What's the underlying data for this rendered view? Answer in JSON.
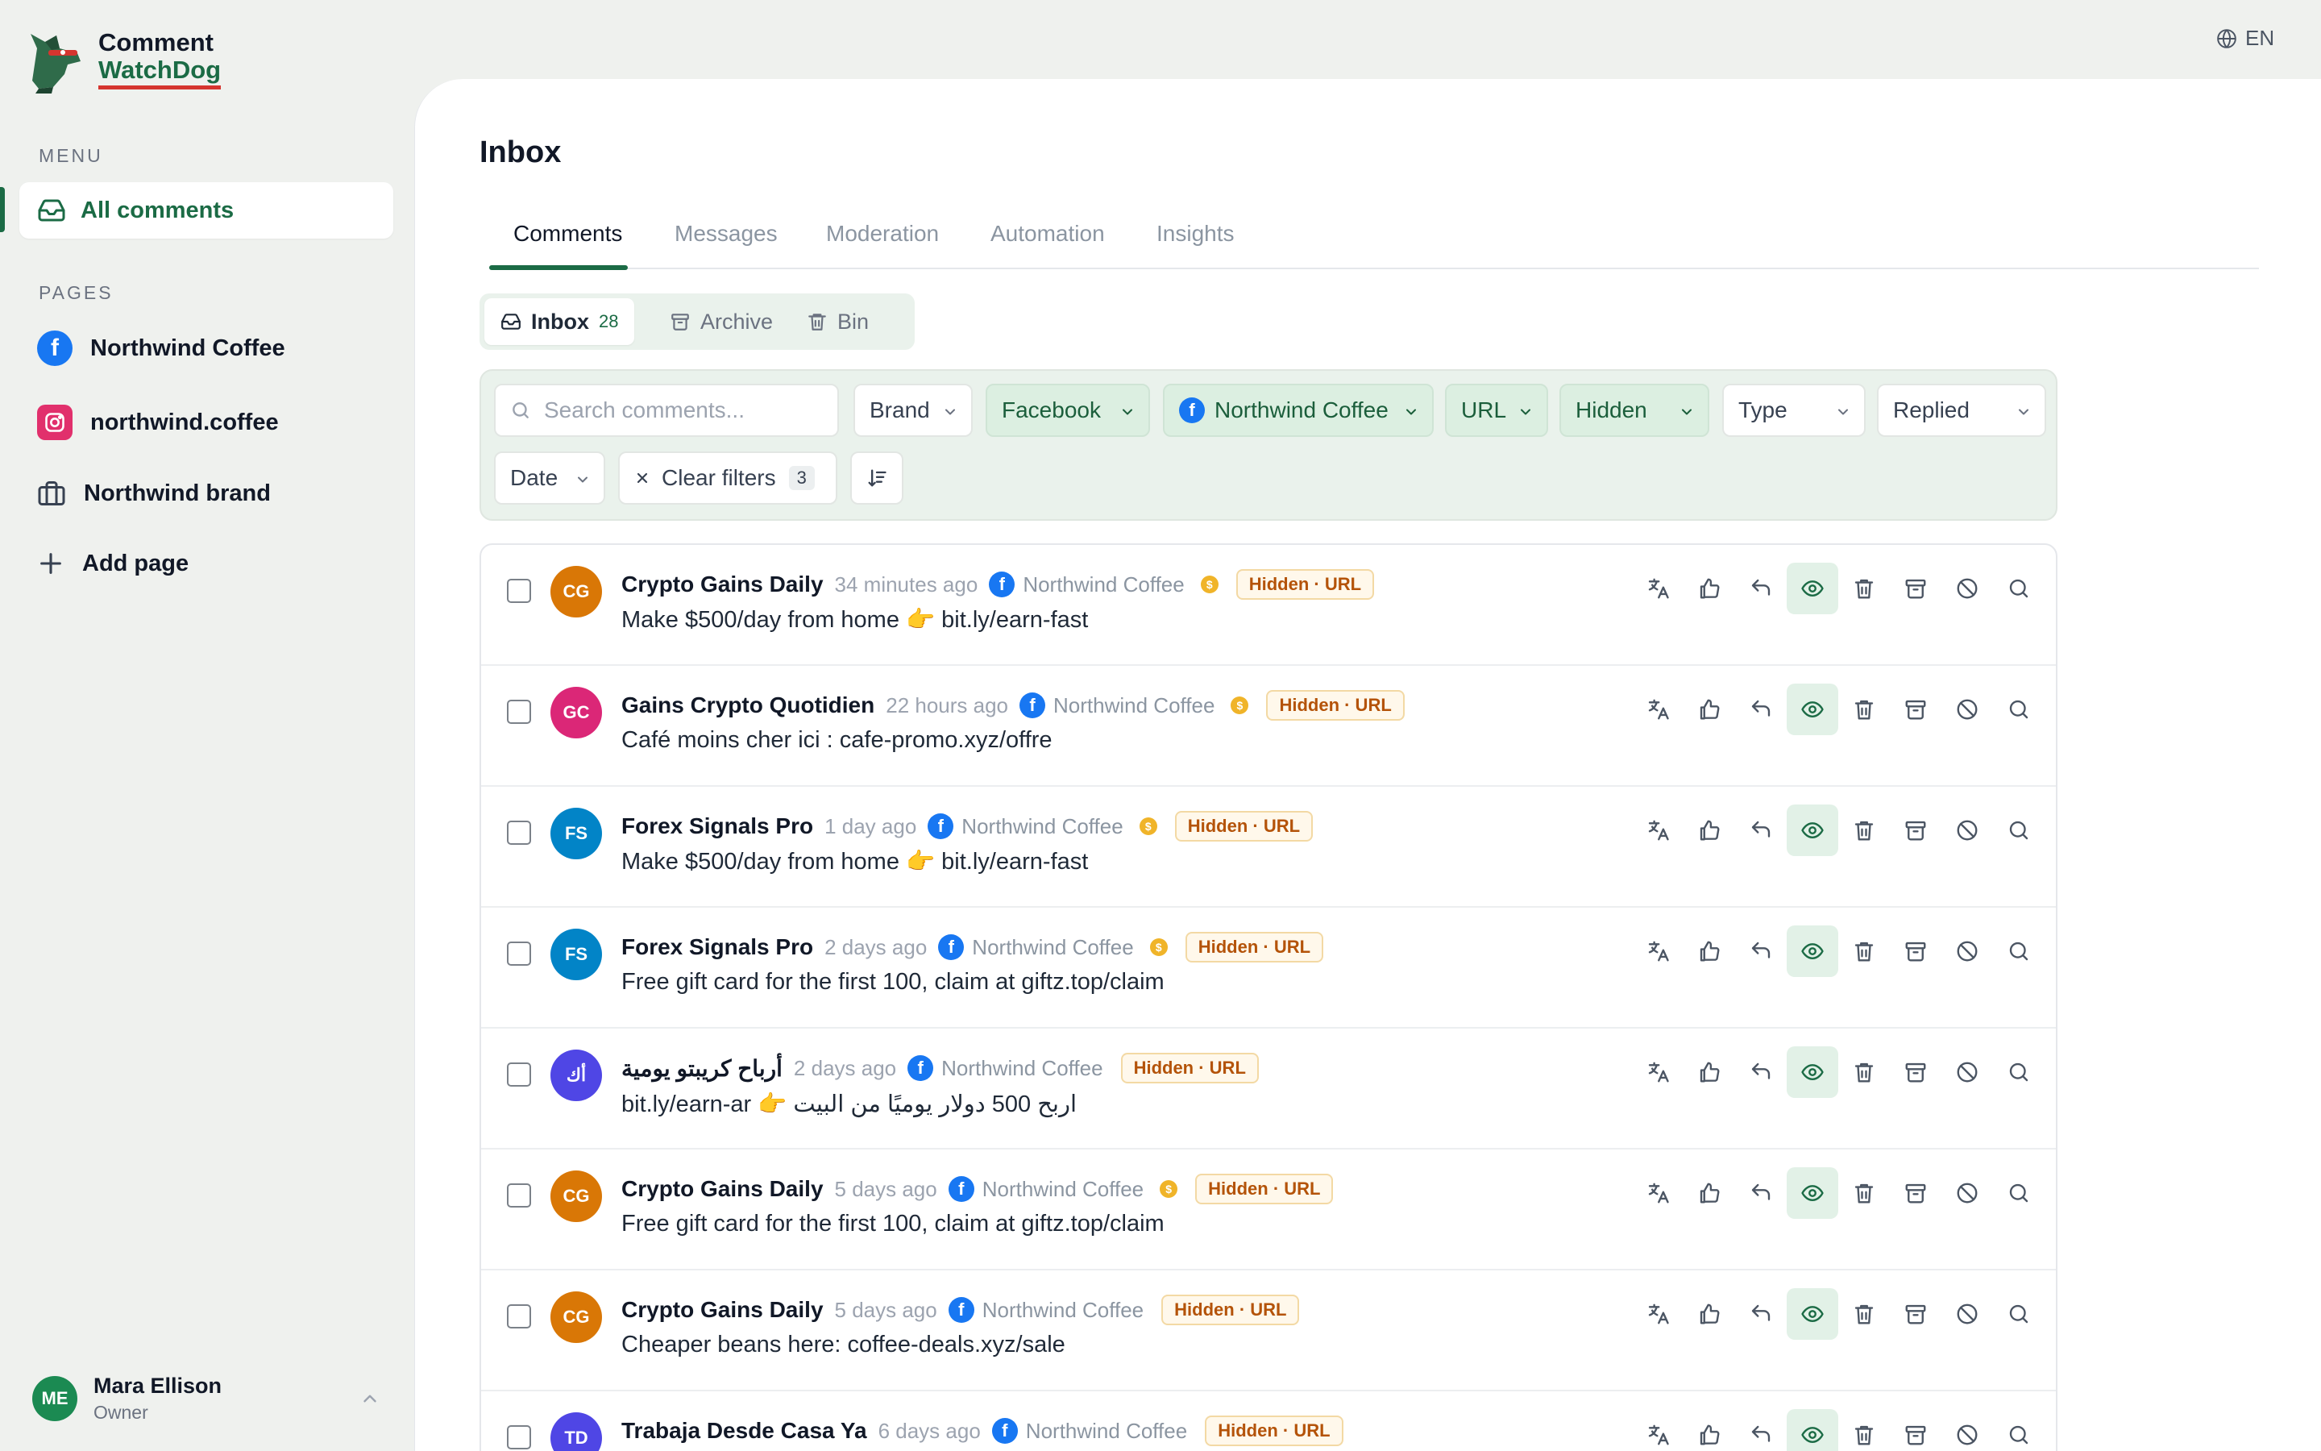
{
  "brand": {
    "line1": "Comment",
    "line2": "WatchDog"
  },
  "sidebar": {
    "menu_title": "MENU",
    "menu_items": [
      {
        "label": "All comments",
        "icon": "inbox-icon"
      }
    ],
    "pages_title": "PAGES",
    "pages": [
      {
        "label": "Northwind Coffee",
        "icon": "facebook-icon"
      },
      {
        "label": "northwind.coffee",
        "icon": "instagram-icon"
      },
      {
        "label": "Northwind brand",
        "icon": "briefcase-icon"
      }
    ],
    "add_page": "Add page",
    "user": {
      "initials": "ME",
      "name": "Mara Ellison",
      "role": "Owner"
    }
  },
  "lang": "EN",
  "main": {
    "title": "Inbox",
    "tabs": [
      "Comments",
      "Messages",
      "Moderation",
      "Automation",
      "Insights"
    ],
    "active_tab": "Comments",
    "segments": [
      {
        "label": "Inbox",
        "count": "28"
      },
      {
        "label": "Archive"
      },
      {
        "label": "Bin"
      }
    ],
    "filters": {
      "search_placeholder": "Search comments...",
      "brand": "Brand",
      "platform": "Facebook",
      "page": "Northwind Coffee",
      "url": "URL",
      "visibility": "Hidden",
      "type": "Type",
      "replied": "Replied",
      "date": "Date",
      "clear": "Clear filters",
      "clear_count": "3"
    }
  },
  "colors": {
    "accent": "#1b6b45",
    "facebook": "#1877f2",
    "tag": "#b45309"
  },
  "comments": [
    {
      "initials": "CG",
      "color": "#d97706",
      "author": "Crypto Gains Daily",
      "time": "34 minutes ago",
      "page": "Northwind Coffee",
      "coin": true,
      "tag": "Hidden · URL",
      "text": "Make $500/day from home 👉  bit.ly/earn-fast"
    },
    {
      "initials": "GC",
      "color": "#db2777",
      "author": "Gains Crypto Quotidien",
      "time": "22 hours ago",
      "page": "Northwind Coffee",
      "coin": true,
      "tag": "Hidden · URL",
      "text": "Café moins cher ici : cafe-promo.xyz/offre"
    },
    {
      "initials": "FS",
      "color": "#0284c7",
      "author": "Forex Signals Pro",
      "time": "1 day ago",
      "page": "Northwind Coffee",
      "coin": true,
      "tag": "Hidden · URL",
      "text": "Make $500/day from home 👉  bit.ly/earn-fast"
    },
    {
      "initials": "FS",
      "color": "#0284c7",
      "author": "Forex Signals Pro",
      "time": "2 days ago",
      "page": "Northwind Coffee",
      "coin": true,
      "tag": "Hidden · URL",
      "text": "Free gift card for the first 100, claim at giftz.top/claim"
    },
    {
      "initials": "أك",
      "color": "#4f46e5",
      "author": "أرباح كريبتو يومية",
      "time": "2 days ago",
      "page": "Northwind Coffee",
      "coin": false,
      "tag": "Hidden · URL",
      "text": "bit.ly/earn-ar 👉  اربح 500 دولار يوميًا من البيت"
    },
    {
      "initials": "CG",
      "color": "#d97706",
      "author": "Crypto Gains Daily",
      "time": "5 days ago",
      "page": "Northwind Coffee",
      "coin": true,
      "tag": "Hidden · URL",
      "text": "Free gift card for the first 100, claim at giftz.top/claim"
    },
    {
      "initials": "CG",
      "color": "#d97706",
      "author": "Crypto Gains Daily",
      "time": "5 days ago",
      "page": "Northwind Coffee",
      "coin": false,
      "tag": "Hidden · URL",
      "text": "Cheaper beans here: coffee-deals.xyz/sale"
    },
    {
      "initials": "TD",
      "color": "#4f46e5",
      "author": "Trabaja Desde Casa Ya",
      "time": "6 days ago",
      "page": "Northwind Coffee",
      "coin": false,
      "tag": "Hidden · URL",
      "text": ""
    }
  ],
  "row_actions": [
    "translate-icon",
    "like-icon",
    "reply-icon",
    "eye-icon",
    "trash-icon",
    "archive-icon",
    "ban-icon",
    "search-icon"
  ]
}
